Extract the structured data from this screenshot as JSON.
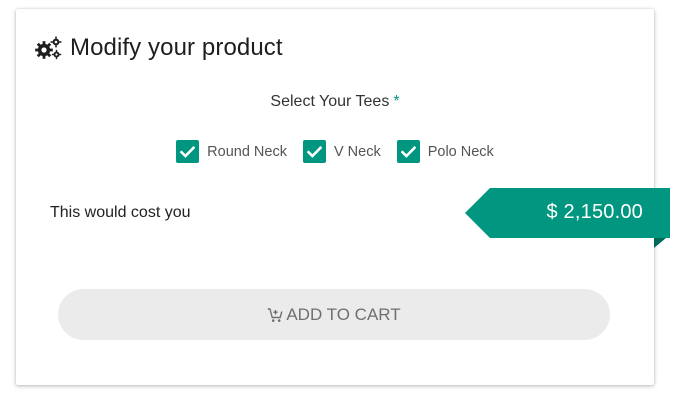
{
  "header": {
    "icon": "gears-icon",
    "title": "Modify your product"
  },
  "select": {
    "label": "Select Your Tees",
    "required_marker": "*"
  },
  "options": [
    {
      "label": "Round Neck",
      "checked": true
    },
    {
      "label": "V Neck",
      "checked": true
    },
    {
      "label": "Polo Neck",
      "checked": true
    }
  ],
  "cost": {
    "label": "This would cost you",
    "price": "$ 2,150.00"
  },
  "cart": {
    "icon": "cart-plus-icon",
    "label": "ADD TO CART"
  },
  "colors": {
    "accent": "#00967f",
    "accent_dark": "#00695a",
    "button_bg": "#ebebeb",
    "button_text": "#6f6f6f"
  }
}
